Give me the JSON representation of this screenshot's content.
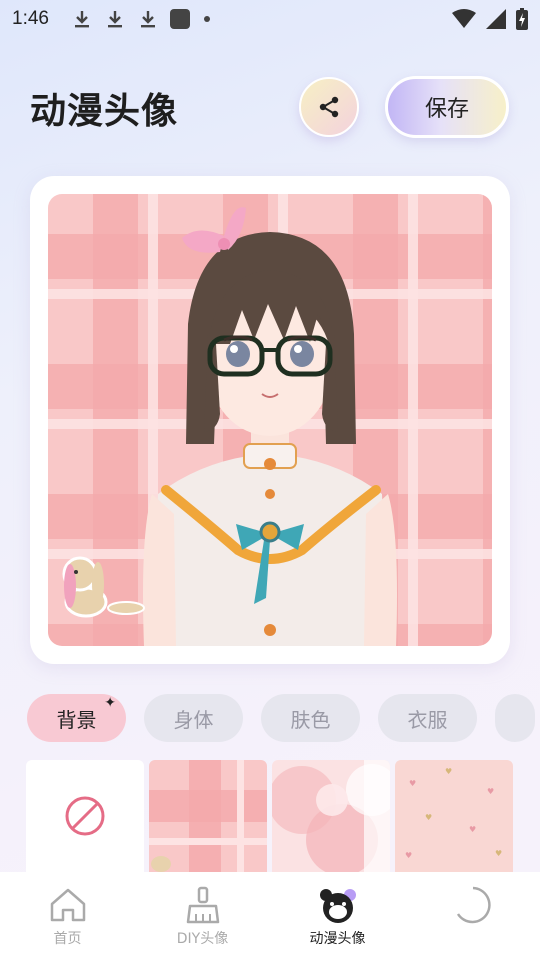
{
  "status_bar": {
    "time": "1:46",
    "icons": [
      "download-icon",
      "download-icon",
      "download-icon",
      "app-icon",
      "dot-icon",
      "wifi-icon",
      "signal-icon",
      "battery-charging-icon"
    ]
  },
  "header": {
    "title": "动漫头像",
    "share_icon": "share-icon",
    "save_label": "保存"
  },
  "preview": {
    "background": "pink-plaid",
    "character": "anime-girl-with-glasses"
  },
  "categories": {
    "tabs": [
      {
        "label": "背景",
        "active": true,
        "badge": "✦"
      },
      {
        "label": "身体",
        "active": false
      },
      {
        "label": "肤色",
        "active": false
      },
      {
        "label": "衣服",
        "active": false
      },
      {
        "label": "",
        "active": false
      }
    ]
  },
  "backgrounds": {
    "options": [
      {
        "name": "none",
        "icon": "prohibited-icon"
      },
      {
        "name": "pink-plaid"
      },
      {
        "name": "pink-watercolor-floral"
      },
      {
        "name": "pink-hearts"
      }
    ]
  },
  "nav": {
    "items": [
      {
        "label": "首页",
        "icon": "home-icon",
        "active": false
      },
      {
        "label": "DIY头像",
        "icon": "brush-icon",
        "active": false
      },
      {
        "label": "动漫头像",
        "icon": "bear-face-icon",
        "active": true
      },
      {
        "label": "",
        "icon": "loading-circle-icon",
        "active": false
      }
    ]
  },
  "colors": {
    "accent_pink": "#f8c9d3",
    "prohibit_red": "#e56c86",
    "tab_inactive": "#e6e6ee"
  }
}
